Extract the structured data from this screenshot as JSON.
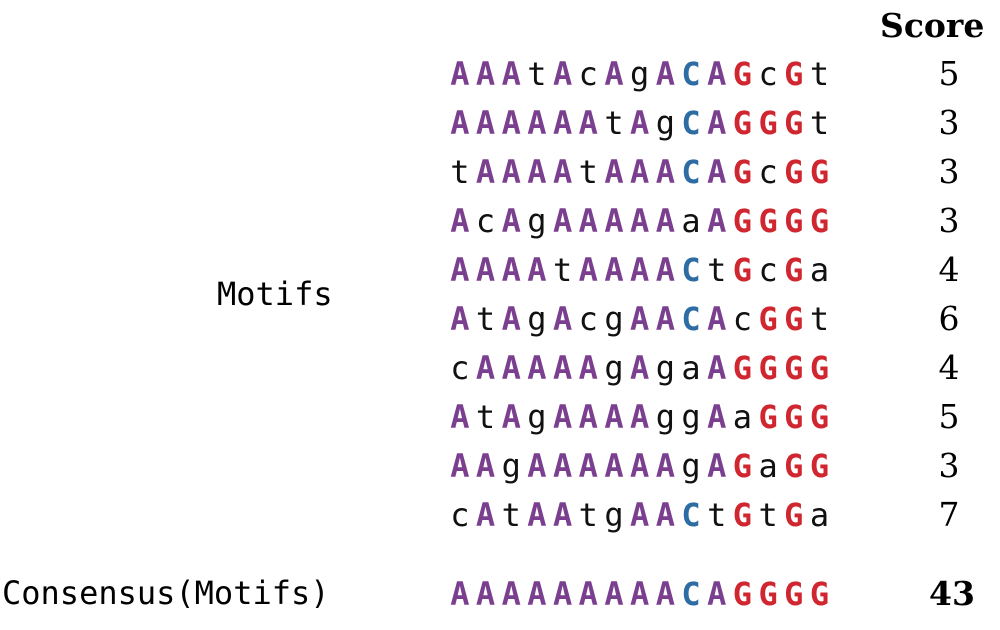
{
  "score_header": "Score",
  "motifs_label": "Motifs",
  "consensus_label": "Consensus(Motifs)",
  "colors": {
    "A": "#7b3f8f",
    "C": "#2e6da4",
    "G": "#d0262f",
    "lowercase": "#111111"
  },
  "motifs": [
    {
      "sequence": "AAAtAcAgACAGcGt",
      "score": "5"
    },
    {
      "sequence": "AAAAAAtAgCAGGGt",
      "score": "3"
    },
    {
      "sequence": "tAAAAtAAACAGcGG",
      "score": "3"
    },
    {
      "sequence": "AcAgAAAAAaAGGGG",
      "score": "3"
    },
    {
      "sequence": "AAAAtAAAACtGcGa",
      "score": "4"
    },
    {
      "sequence": "AtAgAcgAACAcGGt",
      "score": "6"
    },
    {
      "sequence": "cAAAAAgAgaAGGGG",
      "score": "4"
    },
    {
      "sequence": "AtAgAAAAggAaGGG",
      "score": "5"
    },
    {
      "sequence": "AAgAAAAAAgAGaGG",
      "score": "3"
    },
    {
      "sequence": "cAtAAtgAACtGtGa",
      "score": "7"
    }
  ],
  "consensus": {
    "sequence": "AAAAAAAAACAGGGG",
    "score": "43"
  }
}
